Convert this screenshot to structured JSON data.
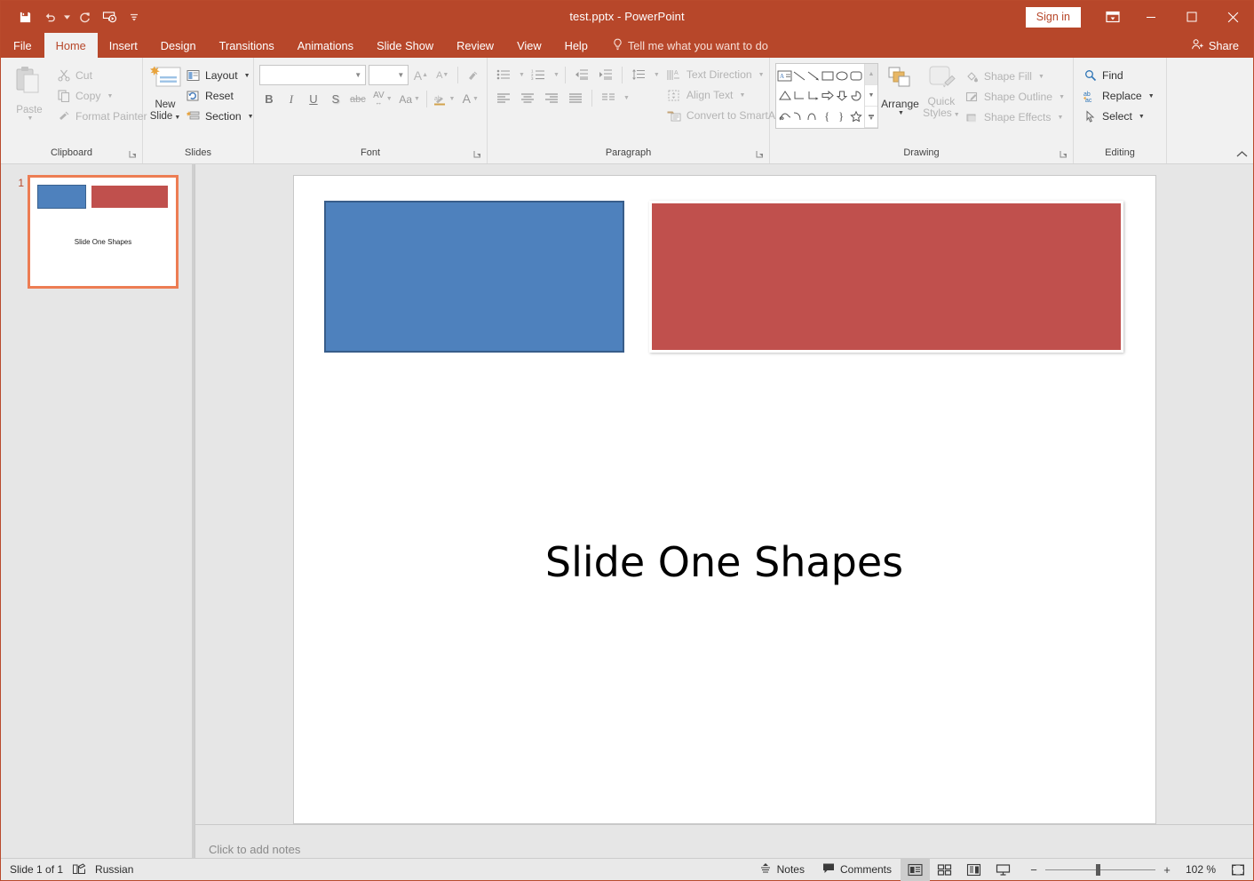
{
  "titlebar": {
    "document_title": "test.pptx  -  PowerPoint",
    "signin_label": "Sign in",
    "quick_access": [
      {
        "name": "save-icon",
        "label": "Save"
      },
      {
        "name": "undo-icon",
        "label": "Undo"
      },
      {
        "name": "redo-icon",
        "label": "Redo"
      },
      {
        "name": "start-slideshow-icon",
        "label": "Start From Beginning"
      },
      {
        "name": "customize-quick-access-icon",
        "label": "Customize Quick Access Toolbar"
      }
    ],
    "window_controls": {
      "ribbon_display": "Ribbon Display Options",
      "minimize": "—",
      "maximize": "□",
      "close": "✕"
    }
  },
  "tabs": [
    {
      "label": "File",
      "active": false
    },
    {
      "label": "Home",
      "active": true
    },
    {
      "label": "Insert",
      "active": false
    },
    {
      "label": "Design",
      "active": false
    },
    {
      "label": "Transitions",
      "active": false
    },
    {
      "label": "Animations",
      "active": false
    },
    {
      "label": "Slide Show",
      "active": false
    },
    {
      "label": "Review",
      "active": false
    },
    {
      "label": "View",
      "active": false
    },
    {
      "label": "Help",
      "active": false
    }
  ],
  "tellme": {
    "label": "Tell me what you want to do",
    "icon": "lightbulb-icon"
  },
  "share": {
    "label": "Share",
    "icon": "share-person-icon"
  },
  "ribbon": {
    "groups": [
      {
        "label": "Clipboard"
      },
      {
        "label": "Slides"
      },
      {
        "label": "Font"
      },
      {
        "label": "Paragraph"
      },
      {
        "label": "Drawing"
      },
      {
        "label": "Editing"
      }
    ],
    "clipboard": {
      "paste_label": "Paste",
      "cut_label": "Cut",
      "copy_label": "Copy",
      "format_painter_label": "Format Painter"
    },
    "slides": {
      "new_slide_line1": "New",
      "new_slide_line2": "Slide",
      "layout_label": "Layout",
      "reset_label": "Reset",
      "section_label": "Section"
    },
    "font": {
      "font_name_value": "",
      "font_name_placeholder": "",
      "font_size_value": "",
      "font_size_placeholder": "",
      "bold": "B",
      "italic": "I",
      "underline": "U",
      "shadow": "S",
      "strikethrough": "abc",
      "char_spacing": "AV",
      "change_case": "Aa",
      "increase_font": "A",
      "decrease_font": "A",
      "clear_formatting": "clear-formatting-icon",
      "text_highlight": "text-highlight-icon",
      "font_color": "A"
    },
    "paragraph": {
      "text_direction_label": "Text Direction",
      "align_text_label": "Align Text",
      "convert_smartart_label": "Convert to SmartArt"
    },
    "drawing": {
      "arrange_label": "Arrange",
      "quick_styles_line1": "Quick",
      "quick_styles_line2": "Styles",
      "shape_fill_label": "Shape Fill",
      "shape_outline_label": "Shape Outline",
      "shape_effects_label": "Shape Effects"
    },
    "editing": {
      "find_label": "Find",
      "replace_label": "Replace",
      "select_label": "Select"
    }
  },
  "thumbnails": [
    {
      "number": "1",
      "title": "Slide One Shapes",
      "selected": true
    }
  ],
  "slide": {
    "title": "Slide One Shapes",
    "shapes": [
      {
        "name": "blue-rectangle",
        "fill": "#4E81BD",
        "outline": "#385D8A"
      },
      {
        "name": "red-rectangle",
        "fill": "#C0504D",
        "outline": "#FFFFFF"
      }
    ]
  },
  "notes": {
    "placeholder": "Click to add notes"
  },
  "statusbar": {
    "slide_counter": "Slide 1 of 1",
    "language": "Russian",
    "spellcheck_icon": "proofing-icon",
    "notes_label": "Notes",
    "comments_label": "Comments",
    "views": [
      {
        "name": "normal-view",
        "active": true
      },
      {
        "name": "slide-sorter-view",
        "active": false
      },
      {
        "name": "reading-view",
        "active": false
      },
      {
        "name": "slideshow-view",
        "active": false
      }
    ],
    "zoom_out": "−",
    "zoom_in": "+",
    "zoom_value": "102 %",
    "fit_to_window": "fit-slide-icon"
  },
  "colors": {
    "accent": "#b7472a",
    "blue_shape": "#4E81BD",
    "red_shape": "#C0504D",
    "selection": "#ed7d53"
  }
}
